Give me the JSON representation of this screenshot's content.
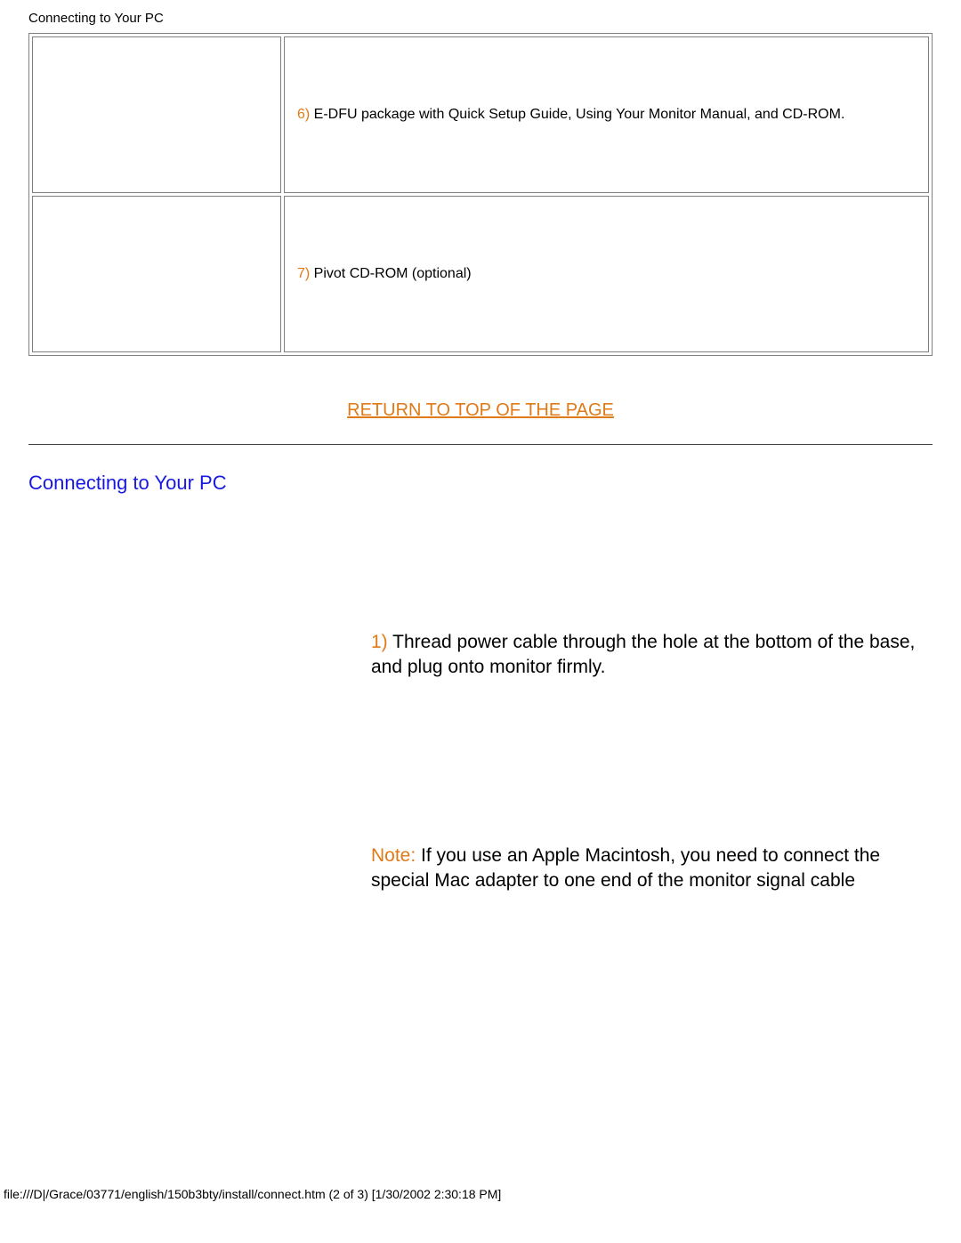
{
  "header": {
    "title": "Connecting to Your PC"
  },
  "pack_items": [
    {
      "num": "6)",
      "text": " E-DFU package with Quick Setup Guide, Using Your Monitor Manual, and CD-ROM."
    },
    {
      "num": "7)",
      "text": " Pivot CD-ROM (optional)"
    }
  ],
  "return_link": "RETURN TO TOP OF THE PAGE",
  "section_title": "Connecting to Your PC",
  "steps": [
    {
      "num": "1)",
      "text": " Thread power cable through the hole at the bottom of the base, and plug onto monitor firmly."
    },
    {
      "note_label": "Note:",
      "text": "  If you use an Apple Macintosh, you need to connect the special Mac adapter to one end of the monitor signal cable"
    }
  ],
  "footer": "file:///D|/Grace/03771/english/150b3bty/install/connect.htm (2 of 3) [1/30/2002 2:30:18 PM]"
}
